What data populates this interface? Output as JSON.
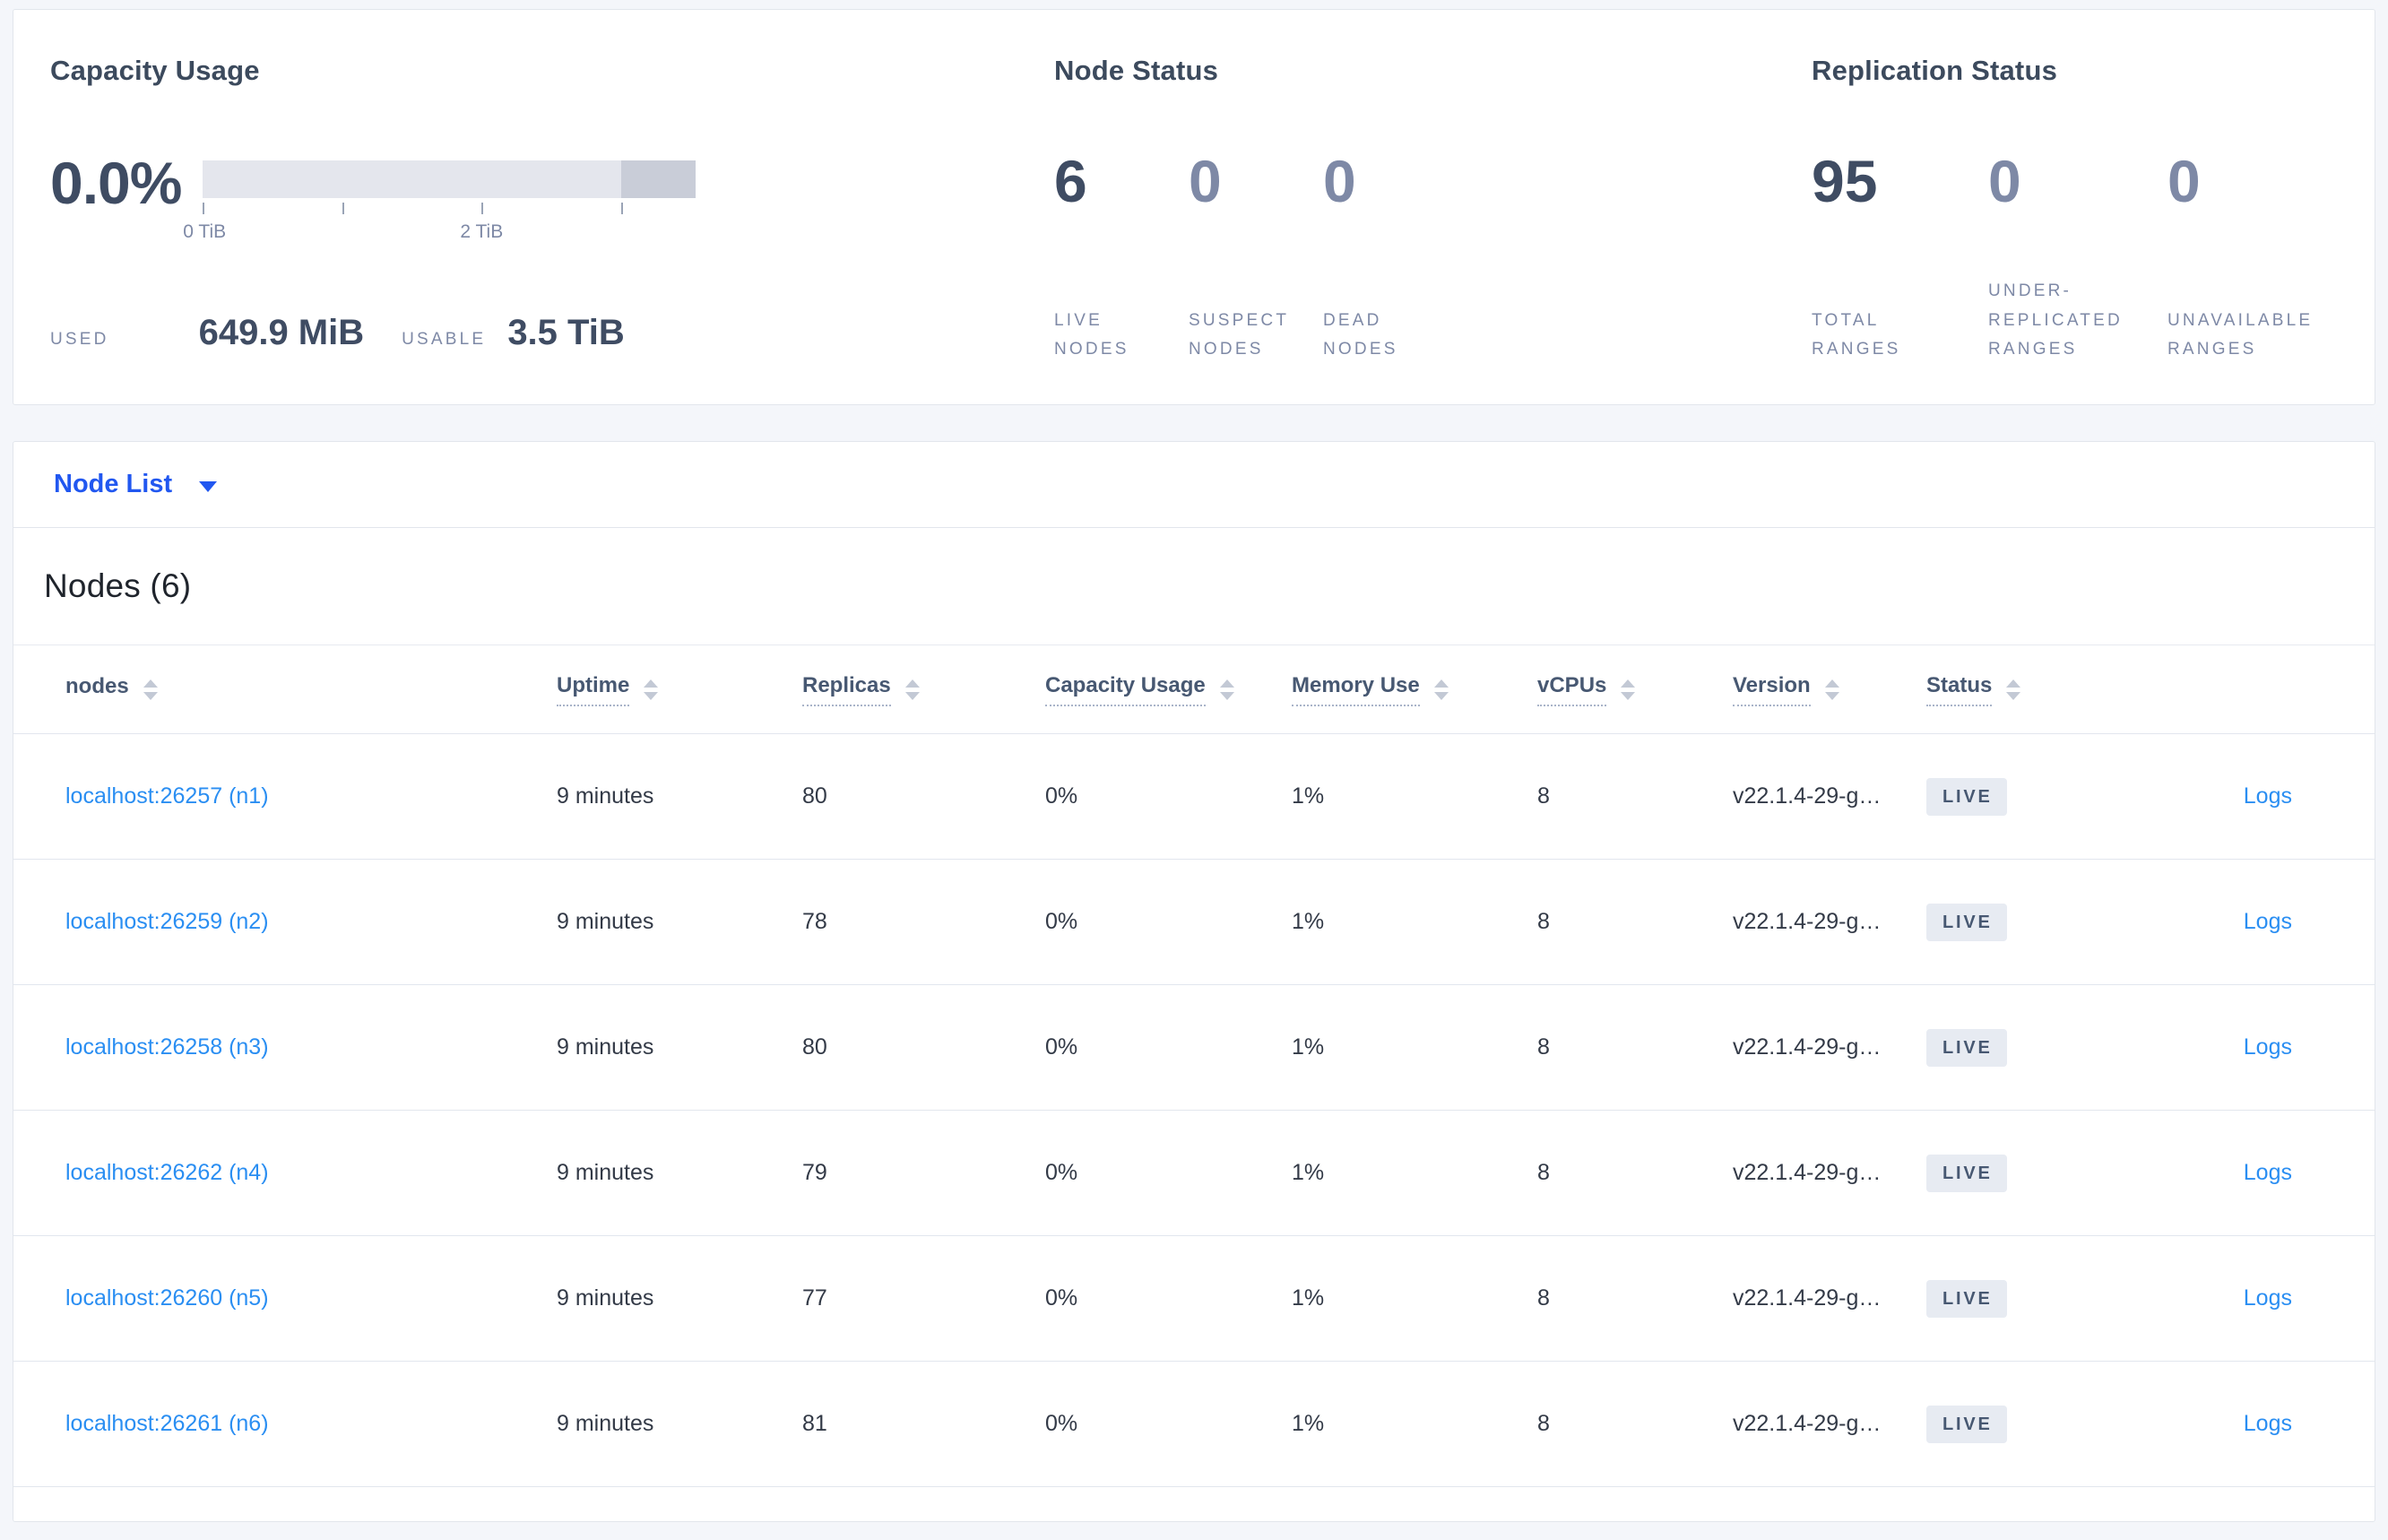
{
  "summary": {
    "capacity": {
      "title": "Capacity Usage",
      "percent": "0.0%",
      "tick_label_0": "0 TiB",
      "tick_label_2": "2 TiB",
      "used_label": "USED",
      "used_value": "649.9 MiB",
      "usable_label": "USABLE",
      "usable_value": "3.5 TiB"
    },
    "node_status": {
      "title": "Node Status",
      "metrics": [
        {
          "value": "6",
          "label": "LIVE NODES"
        },
        {
          "value": "0",
          "label": "SUSPECT NODES"
        },
        {
          "value": "0",
          "label": "DEAD NODES"
        }
      ]
    },
    "replication": {
      "title": "Replication Status",
      "metrics": [
        {
          "value": "95",
          "label": "TOTAL RANGES"
        },
        {
          "value": "0",
          "label": "UNDER-REPLICATED RANGES"
        },
        {
          "value": "0",
          "label": "UNAVAILABLE RANGES"
        }
      ]
    }
  },
  "node_list": {
    "selector_label": "Node List",
    "heading": "Nodes (6)"
  },
  "table": {
    "columns": [
      {
        "label": "nodes",
        "sortable": true
      },
      {
        "label": "Uptime",
        "sortable": true
      },
      {
        "label": "Replicas",
        "sortable": true
      },
      {
        "label": "Capacity Usage",
        "sortable": true
      },
      {
        "label": "Memory Use",
        "sortable": true
      },
      {
        "label": "vCPUs",
        "sortable": true
      },
      {
        "label": "Version",
        "sortable": true
      },
      {
        "label": "Status",
        "sortable": true
      }
    ],
    "rows": [
      {
        "addr": "localhost:26257 (n1)",
        "uptime": "9 minutes",
        "replicas": "80",
        "capacity": "0%",
        "memory": "1%",
        "vcpus": "8",
        "version": "v22.1.4-29-g…",
        "status": "LIVE",
        "logs_label": "Logs"
      },
      {
        "addr": "localhost:26259 (n2)",
        "uptime": "9 minutes",
        "replicas": "78",
        "capacity": "0%",
        "memory": "1%",
        "vcpus": "8",
        "version": "v22.1.4-29-g…",
        "status": "LIVE",
        "logs_label": "Logs"
      },
      {
        "addr": "localhost:26258 (n3)",
        "uptime": "9 minutes",
        "replicas": "80",
        "capacity": "0%",
        "memory": "1%",
        "vcpus": "8",
        "version": "v22.1.4-29-g…",
        "status": "LIVE",
        "logs_label": "Logs"
      },
      {
        "addr": "localhost:26262 (n4)",
        "uptime": "9 minutes",
        "replicas": "79",
        "capacity": "0%",
        "memory": "1%",
        "vcpus": "8",
        "version": "v22.1.4-29-g…",
        "status": "LIVE",
        "logs_label": "Logs"
      },
      {
        "addr": "localhost:26260 (n5)",
        "uptime": "9 minutes",
        "replicas": "77",
        "capacity": "0%",
        "memory": "1%",
        "vcpus": "8",
        "version": "v22.1.4-29-g…",
        "status": "LIVE",
        "logs_label": "Logs"
      },
      {
        "addr": "localhost:26261 (n6)",
        "uptime": "9 minutes",
        "replicas": "81",
        "capacity": "0%",
        "memory": "1%",
        "vcpus": "8",
        "version": "v22.1.4-29-g…",
        "status": "LIVE",
        "logs_label": "Logs"
      }
    ]
  },
  "colors": {
    "page_background": "#f4f6fa",
    "selector_blue": "#2157f0",
    "table_link_blue": "#2a8ef2",
    "number_dark": "#3f4c63",
    "number_muted": "#7e89a6",
    "bar_track": "#e4e6ed",
    "bar_overflow_segment": "#c9cdd8",
    "badge_background": "#e7ebf2",
    "badge_text": "#475872"
  }
}
